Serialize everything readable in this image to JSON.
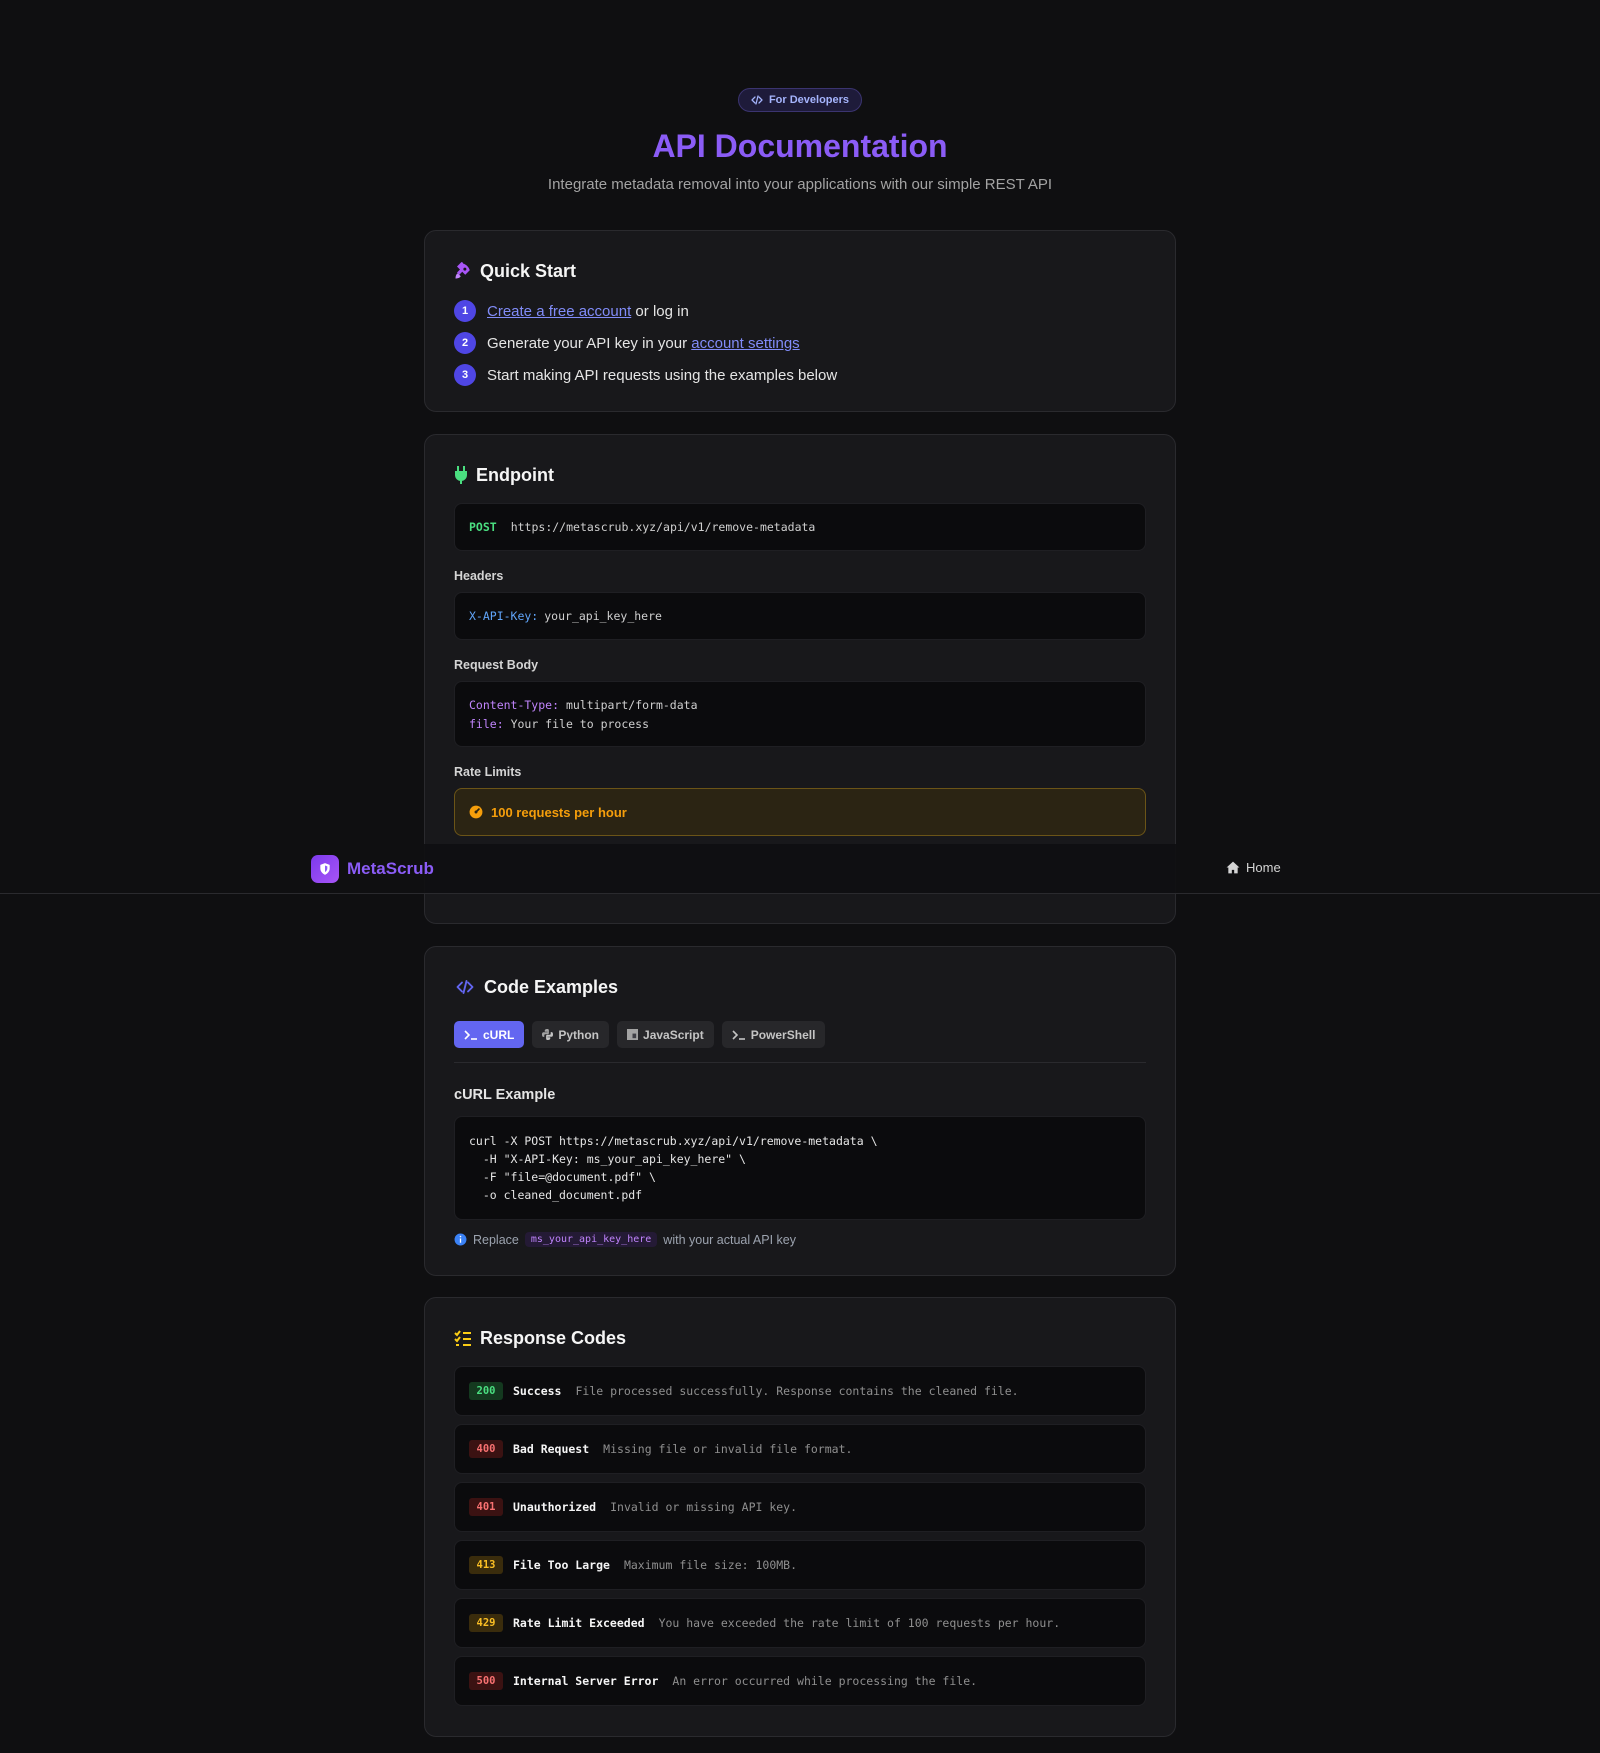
{
  "hero": {
    "badge": "For Developers",
    "title": "API Documentation",
    "subtitle": "Integrate metadata removal into your applications with our simple REST API"
  },
  "quick_start": {
    "title": "Quick Start",
    "steps": [
      {
        "num": "1",
        "link": "Create a free account",
        "text": " or log in"
      },
      {
        "num": "2",
        "text": "Generate your API key in your ",
        "link": "account settings"
      },
      {
        "num": "3",
        "text": "Start making API requests using the examples below"
      }
    ]
  },
  "endpoint": {
    "title": "Endpoint",
    "method": "POST",
    "url": "https://metascrub.xyz/api/v1/remove-metadata",
    "headers_label": "Headers",
    "header_key": "X-API-Key:",
    "header_value": "your_api_key_here",
    "body_label": "Request Body",
    "body_lines": [
      {
        "key": "Content-Type:",
        "value": "multipart/form-data"
      },
      {
        "key": "file:",
        "value": "Your file to process"
      }
    ],
    "rate_label": "Rate Limits",
    "rate_text": "100 requests per hour"
  },
  "navbar": {
    "brand": "MetaScrub",
    "home": "Home"
  },
  "code_examples": {
    "title": "Code Examples",
    "tabs": [
      "cURL",
      "Python",
      "JavaScript",
      "PowerShell"
    ],
    "active_tab": "cURL",
    "example_title": "cURL Example",
    "code": "curl -X POST https://metascrub.xyz/api/v1/remove-metadata \\\n  -H \"X-API-Key: ms_your_api_key_here\" \\\n  -F \"file=@document.pdf\" \\\n  -o cleaned_document.pdf",
    "hint_prefix": "Replace",
    "hint_code": "ms_your_api_key_here",
    "hint_suffix": "with your actual API key"
  },
  "response_codes": {
    "title": "Response Codes",
    "items": [
      {
        "code": "200",
        "name": "Success",
        "desc": "File processed successfully. Response contains the cleaned file.",
        "color": "green"
      },
      {
        "code": "400",
        "name": "Bad Request",
        "desc": "Missing file or invalid file format.",
        "color": "red"
      },
      {
        "code": "401",
        "name": "Unauthorized",
        "desc": "Invalid or missing API key.",
        "color": "red"
      },
      {
        "code": "413",
        "name": "File Too Large",
        "desc": "Maximum file size: 100MB.",
        "color": "yellow"
      },
      {
        "code": "429",
        "name": "Rate Limit Exceeded",
        "desc": "You have exceeded the rate limit of 100 requests per hour.",
        "color": "yellow"
      },
      {
        "code": "500",
        "name": "Internal Server Error",
        "desc": "An error occurred while processing the file.",
        "color": "red"
      }
    ]
  },
  "colors": {
    "accent": "#8b5cf6",
    "primary": "#6366f1",
    "success": "#4ade80",
    "error": "#f87171",
    "warning": "#f59e0b"
  }
}
